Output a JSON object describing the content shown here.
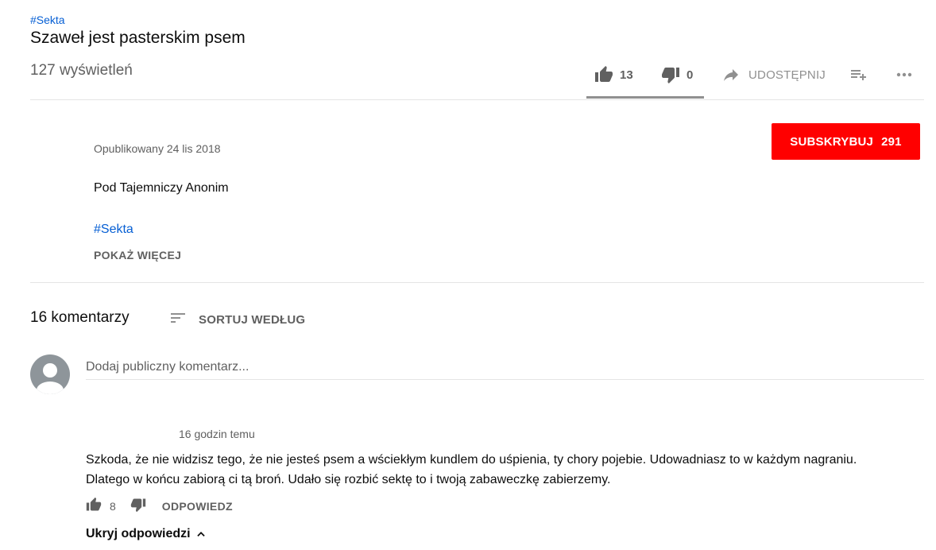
{
  "video": {
    "hashtag": "#Sekta",
    "title": "Szaweł jest pasterskim psem",
    "views": "127 wyświetleń",
    "likes": "13",
    "dislikes": "0",
    "share_label": "UDOSTĘPNIJ",
    "sentiment_like_fraction": 1.0
  },
  "channel": {
    "published": "Opublikowany 24 lis 2018",
    "subscribe_label": "SUBSKRYBUJ",
    "subscriber_count": "291",
    "subscribe_color": "#ff0000"
  },
  "description": {
    "text": "Pod Tajemniczy Anonim",
    "hashtag": "#Sekta",
    "show_more": "POKAŻ WIĘCEJ"
  },
  "comments": {
    "count_label": "16 komentarzy",
    "sort_label": "SORTUJ WEDŁUG",
    "add_placeholder": "Dodaj publiczny komentarz...",
    "items": [
      {
        "time": "16 godzin temu",
        "text": "Szkoda, że nie widzisz tego, że nie jesteś psem a wściekłym kundlem do uśpienia, ty chory pojebie. Udowadniasz to w każdym nagraniu. Dlatego w końcu zabiorą ci tą broń. Udało się rozbić sektę to i twoją zabaweczkę zabierzemy.",
        "likes": "8",
        "reply_label": "ODPOWIEDZ",
        "hide_replies_label": "Ukryj odpowiedzi"
      }
    ]
  },
  "icons": {
    "like": "thumb-up-icon",
    "dislike": "thumb-down-icon",
    "share": "share-arrow-icon",
    "add_to_playlist": "playlist-add-icon",
    "more": "more-horizontal-icon",
    "sort": "sort-icon",
    "chevron": "chevron-up-icon"
  },
  "colors": {
    "link": "#065fd4",
    "secondary_text": "#606060"
  }
}
